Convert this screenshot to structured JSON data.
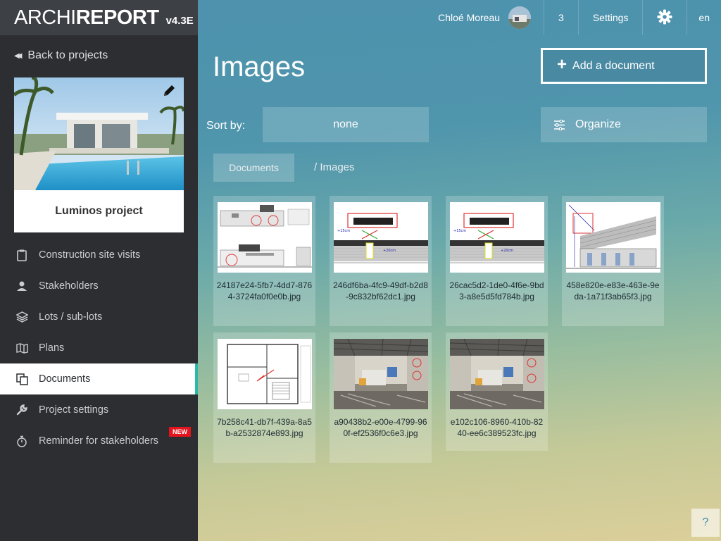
{
  "brand": {
    "name_light": "ARCHI",
    "name_bold": "REPORT",
    "version": "v4.3E"
  },
  "sidebar": {
    "back_label": "Back to projects",
    "project_name": "Luminos project",
    "items": [
      {
        "label": "Construction site visits",
        "icon": "clipboard-icon"
      },
      {
        "label": "Stakeholders",
        "icon": "user-icon"
      },
      {
        "label": "Lots / sub-lots",
        "icon": "layers-icon"
      },
      {
        "label": "Plans",
        "icon": "map-icon"
      },
      {
        "label": "Documents",
        "icon": "documents-icon",
        "active": true
      },
      {
        "label": "Project settings",
        "icon": "wrench-icon"
      },
      {
        "label": "Reminder for stakeholders",
        "icon": "stopwatch-icon",
        "badge": "NEW"
      }
    ]
  },
  "topbar": {
    "user_name": "Chloé Moreau",
    "notifications": "3",
    "settings_label": "Settings",
    "language": "en"
  },
  "main": {
    "title": "Images",
    "add_document_label": "Add a document",
    "sort_label": "Sort by:",
    "sort_value": "none",
    "organize_label": "Organize",
    "breadcrumb_root": "Documents",
    "breadcrumb_current": "/ Images",
    "help_label": "?"
  },
  "files": [
    {
      "name": "24187e24-5fb7-4dd7-8764-3724fa0f0e0b.jpg",
      "kind": "plan"
    },
    {
      "name": "246df6ba-4fc9-49df-b2d8-9c832bf62dc1.jpg",
      "kind": "elevation"
    },
    {
      "name": "26cac5d2-1de0-4f6e-9bd3-a8e5d5fd784b.jpg",
      "kind": "elevation"
    },
    {
      "name": "458e820e-e83e-463e-9eda-1a71f3ab65f3.jpg",
      "kind": "section"
    },
    {
      "name": "7b258c41-db7f-439a-8a5b-a2532874e893.jpg",
      "kind": "floorplan"
    },
    {
      "name": "a90438b2-e00e-4799-960f-ef2536f0c6e3.jpg",
      "kind": "photo"
    },
    {
      "name": "e102c106-8960-410b-8240-ee6c389523fc.jpg",
      "kind": "photo"
    }
  ],
  "colors": {
    "accent": "#2ab8a7",
    "sidebar_bg": "#2c2e32",
    "badge_red": "#e4141e"
  }
}
